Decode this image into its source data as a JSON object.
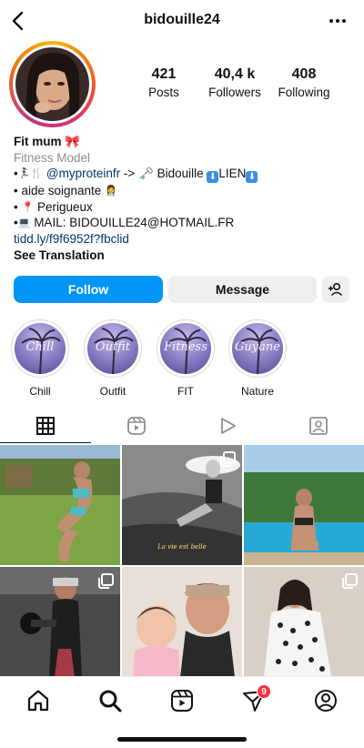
{
  "header": {
    "username": "bidouille24"
  },
  "stats": {
    "posts_value": "421",
    "posts_label": "Posts",
    "followers_value": "40,4 k",
    "followers_label": "Followers",
    "following_value": "408",
    "following_label": "Following"
  },
  "bio": {
    "name": "Fit mum 🎀",
    "category": "Fitness Model",
    "line1_mention": "@myproteinfr",
    "line1_text": " -> 🗝️ Bidouille ",
    "line1_lien": "LIEN",
    "line2": " aide soignante ",
    "line3": " Perigueux",
    "line4": " MAIL: BIDOUILLE24@HOTMAIL.FR",
    "link": "tidd.ly/f9f6952f?fbclid",
    "see_translation": "See Translation"
  },
  "buttons": {
    "follow": "Follow",
    "message": "Message"
  },
  "highlights": [
    {
      "label": "Chill",
      "cover_text": "Chill"
    },
    {
      "label": "Outfit",
      "cover_text": "Outfit"
    },
    {
      "label": "FIT",
      "cover_text": "Fitness"
    },
    {
      "label": "Nature",
      "cover_text": "Guyane"
    }
  ],
  "grid": {
    "post2_caption": "La vie est belle"
  },
  "nav": {
    "notifications_count": "9"
  },
  "colors": {
    "accent": "#0095f6",
    "badge": "#ff3040",
    "link": "#00376b",
    "muted": "#8e8e8e"
  },
  "icons": [
    "back-icon",
    "more-icon",
    "grid-icon",
    "reels-icon",
    "video-icon",
    "tagged-icon",
    "home-icon",
    "search-icon",
    "reels-nav-icon",
    "send-icon",
    "profile-icon",
    "add-user-icon"
  ]
}
